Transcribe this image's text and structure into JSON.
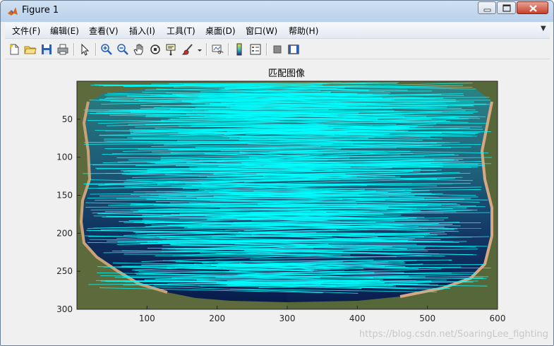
{
  "window": {
    "title": "Figure 1"
  },
  "menu": {
    "items": [
      "文件(F)",
      "编辑(E)",
      "查看(V)",
      "插入(I)",
      "工具(T)",
      "桌面(D)",
      "窗口(W)",
      "帮助(H)"
    ]
  },
  "toolbar": {
    "buttons": [
      "new-figure",
      "open-file",
      "save-figure",
      "print-figure",
      "edit-plot",
      "zoom-in",
      "zoom-out",
      "pan",
      "rotate-3d",
      "data-cursor",
      "brush",
      "link-plot",
      "insert-colorbar",
      "insert-legend",
      "hide-plot-tools",
      "show-plot-tools"
    ]
  },
  "chart_data": {
    "type": "image-with-match-lines",
    "title": "匹配图像",
    "xlabel": "",
    "ylabel": "",
    "xlim": [
      0,
      600
    ],
    "ylim": [
      300,
      0
    ],
    "xticks": [
      100,
      200,
      300,
      400,
      500,
      600
    ],
    "yticks": [
      50,
      100,
      150,
      200,
      250,
      300
    ],
    "line_color": "#00ffff",
    "image_panels": [
      "left",
      "right"
    ]
  },
  "watermark": "https://blog.csdn.net/SoaringLee_fighting"
}
